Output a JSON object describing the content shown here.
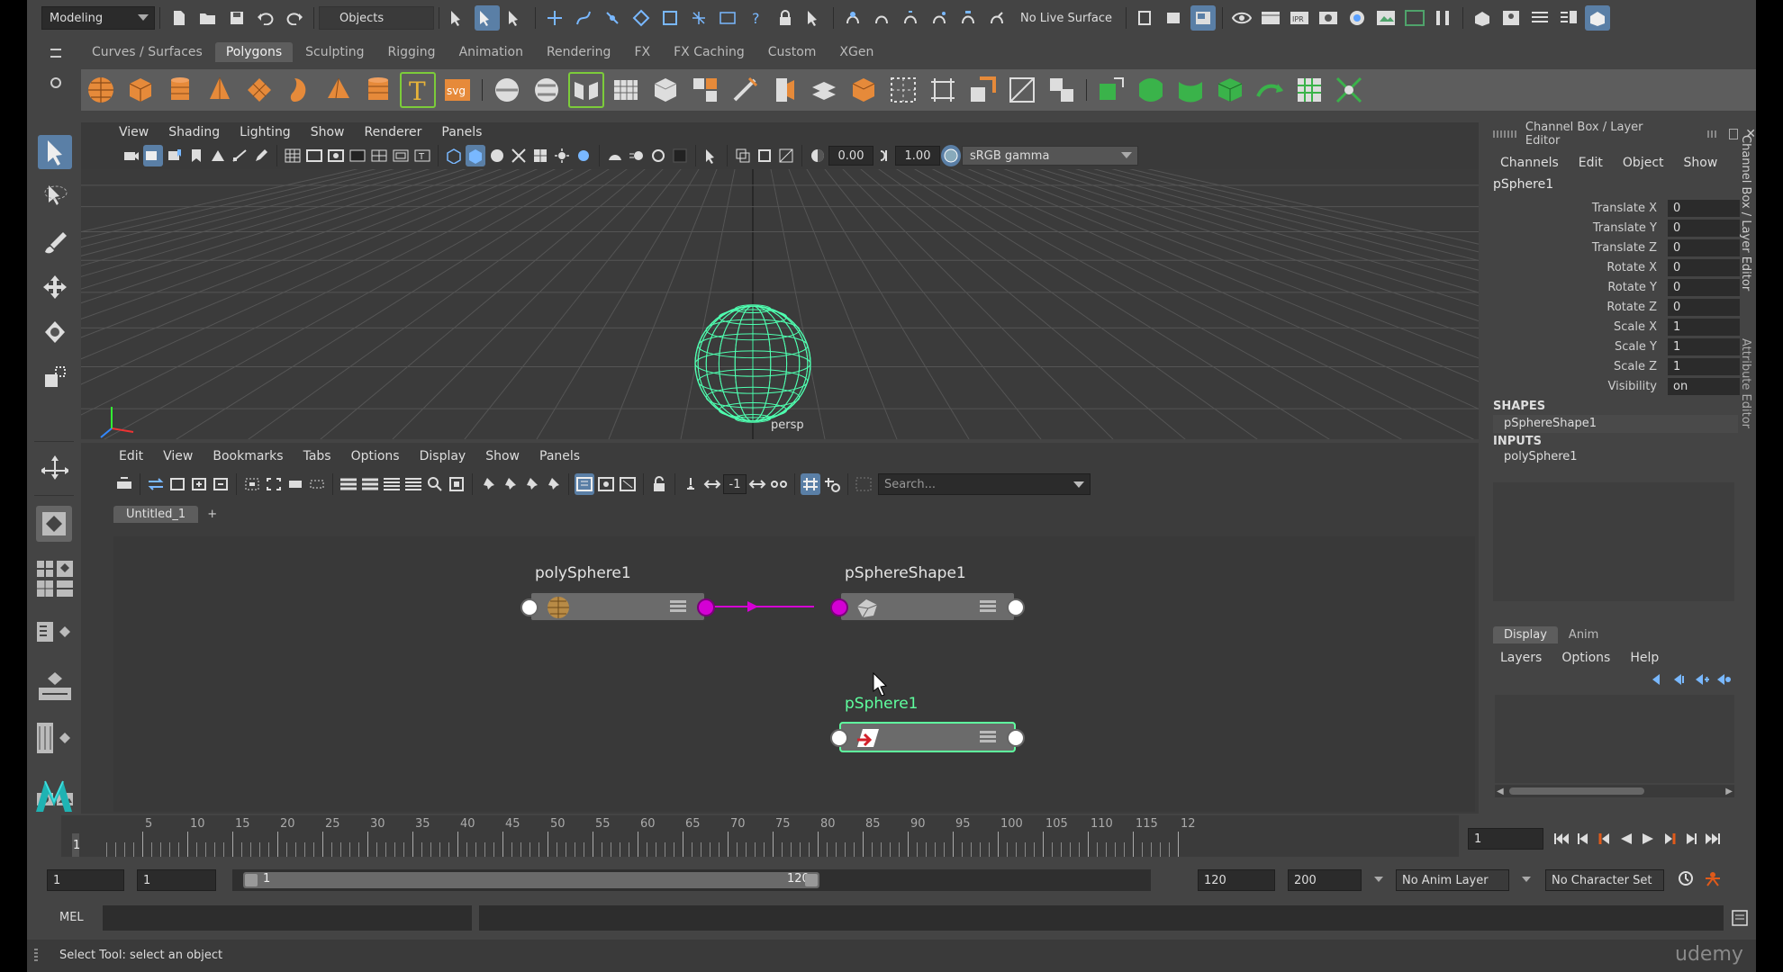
{
  "top": {
    "mode": "Modeling",
    "selection_mode": "Objects",
    "live_surface": "No Live Surface"
  },
  "shelf": {
    "tabs": [
      {
        "label": "Curves / Surfaces",
        "active": false
      },
      {
        "label": "Polygons",
        "active": true
      },
      {
        "label": "Sculpting",
        "active": false
      },
      {
        "label": "Rigging",
        "active": false
      },
      {
        "label": "Animation",
        "active": false
      },
      {
        "label": "Rendering",
        "active": false
      },
      {
        "label": "FX",
        "active": false
      },
      {
        "label": "FX Caching",
        "active": false
      },
      {
        "label": "Custom",
        "active": false
      },
      {
        "label": "XGen",
        "active": false
      }
    ]
  },
  "viewport": {
    "menu": [
      "View",
      "Shading",
      "Lighting",
      "Show",
      "Renderer",
      "Panels"
    ],
    "exposure": "0.00",
    "gamma": "1.00",
    "color_space": "sRGB gamma",
    "camera": "persp"
  },
  "node_editor": {
    "menu": [
      "Edit",
      "View",
      "Bookmarks",
      "Tabs",
      "Options",
      "Display",
      "Show",
      "Panels"
    ],
    "field_value": "-1",
    "search_placeholder": "Search...",
    "tab": "Untitled_1",
    "add_tab": "+",
    "nodes": {
      "poly": "polySphere1",
      "shape": "pSphereShape1",
      "transform": "pSphere1"
    }
  },
  "channel_box": {
    "header": "Channel Box / Layer Editor",
    "menu": [
      "Channels",
      "Edit",
      "Object",
      "Show"
    ],
    "object": "pSphere1",
    "attributes": [
      {
        "name": "Translate X",
        "value": "0"
      },
      {
        "name": "Translate Y",
        "value": "0"
      },
      {
        "name": "Translate Z",
        "value": "0"
      },
      {
        "name": "Rotate X",
        "value": "0"
      },
      {
        "name": "Rotate Y",
        "value": "0"
      },
      {
        "name": "Rotate Z",
        "value": "0"
      },
      {
        "name": "Scale X",
        "value": "1"
      },
      {
        "name": "Scale Y",
        "value": "1"
      },
      {
        "name": "Scale Z",
        "value": "1"
      },
      {
        "name": "Visibility",
        "value": "on"
      }
    ],
    "shapes_label": "SHAPES",
    "shape": "pSphereShape1",
    "inputs_label": "INPUTS",
    "input": "polySphere1",
    "side_tabs": {
      "top": "Channel Box / Layer Editor",
      "bottom": "Attribute Editor"
    }
  },
  "layer_editor": {
    "tabs": [
      "Display",
      "Anim"
    ],
    "menu": [
      "Layers",
      "Options",
      "Help"
    ]
  },
  "timeline": {
    "labels": [
      "5",
      "10",
      "15",
      "20",
      "25",
      "30",
      "35",
      "40",
      "45",
      "50",
      "55",
      "60",
      "65",
      "70",
      "75",
      "80",
      "85",
      "90",
      "95",
      "100",
      "105",
      "110",
      "115",
      "12"
    ],
    "start_marker": "1",
    "current_frame": "1"
  },
  "range": {
    "start": "1",
    "playback_start": "1",
    "slider_start": "1",
    "slider_end": "120",
    "playback_end": "120",
    "end": "200",
    "anim_layer": "No Anim Layer",
    "character_set": "No Character Set"
  },
  "cmd": {
    "label": "MEL"
  },
  "status": "Select Tool: select an object",
  "watermark": "udemy",
  "colors": {
    "accent": "#5a7fa6",
    "wire": "#4fffb0",
    "connection": "#d400d4"
  }
}
